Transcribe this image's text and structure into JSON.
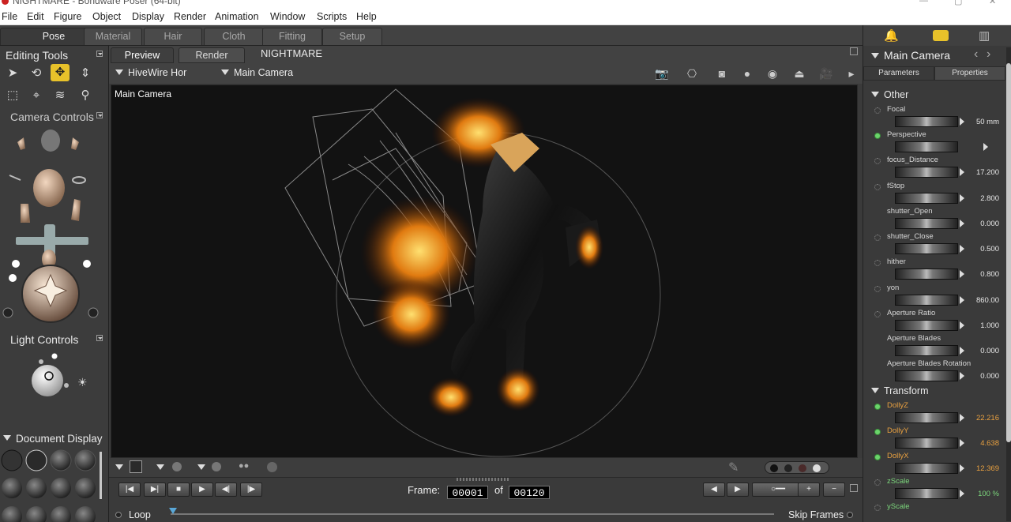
{
  "window": {
    "title": "NIGHTMARE - Bondware Poser (64-bit)"
  },
  "menu": [
    "File",
    "Edit",
    "Figure",
    "Object",
    "Display",
    "Render",
    "Animation",
    "Window",
    "Scripts",
    "Help"
  ],
  "rooms": [
    "Pose",
    "Material",
    "Hair",
    "Cloth",
    "Fitting",
    "Setup"
  ],
  "left": {
    "editing_tools": "Editing Tools",
    "camera_controls": "Camera Controls",
    "light_controls": "Light Controls",
    "document_display": "Document  Display"
  },
  "view": {
    "tabs": [
      "Preview",
      "Render"
    ],
    "document_title": "NIGHTMARE",
    "figure_dropdown": "HiveWire Hor",
    "camera_dropdown": "Main Camera",
    "viewport_label": "Main Camera"
  },
  "transport": {
    "frame_label": "Frame:",
    "current_frame": "00001",
    "of_label": "of",
    "total_frames": "00120",
    "loop_label": "Loop",
    "skip_frames_label": "Skip Frames"
  },
  "right": {
    "title": "Main Camera",
    "tabs": [
      "Parameters",
      "Properties"
    ],
    "group_other": "Other",
    "group_transform": "Transform",
    "params": [
      {
        "label": "Focal",
        "value": "50 mm"
      },
      {
        "label": "Perspective",
        "value": ""
      },
      {
        "label": "focus_Distance",
        "value": "17.200"
      },
      {
        "label": "fStop",
        "value": "2.800"
      },
      {
        "label": "shutter_Open",
        "value": "0.000"
      },
      {
        "label": "shutter_Close",
        "value": "0.500"
      },
      {
        "label": "hither",
        "value": "0.800"
      },
      {
        "label": "yon",
        "value": "860.00"
      },
      {
        "label": "Aperture Ratio",
        "value": "1.000"
      },
      {
        "label": "Aperture Blades",
        "value": "0.000"
      },
      {
        "label": "Aperture Blades Rotation",
        "value": "0.000"
      }
    ],
    "transform": [
      {
        "label": "DollyZ",
        "value": "22.216"
      },
      {
        "label": "DollyY",
        "value": "4.638"
      },
      {
        "label": "DollyX",
        "value": "12.369"
      },
      {
        "label": "zScale",
        "value": "100 %"
      },
      {
        "label": "yScale",
        "value": ""
      }
    ]
  },
  "colors": {
    "accent": "#e8c22a",
    "orange_value": "#e8a040",
    "green_value": "#7cd67c"
  }
}
